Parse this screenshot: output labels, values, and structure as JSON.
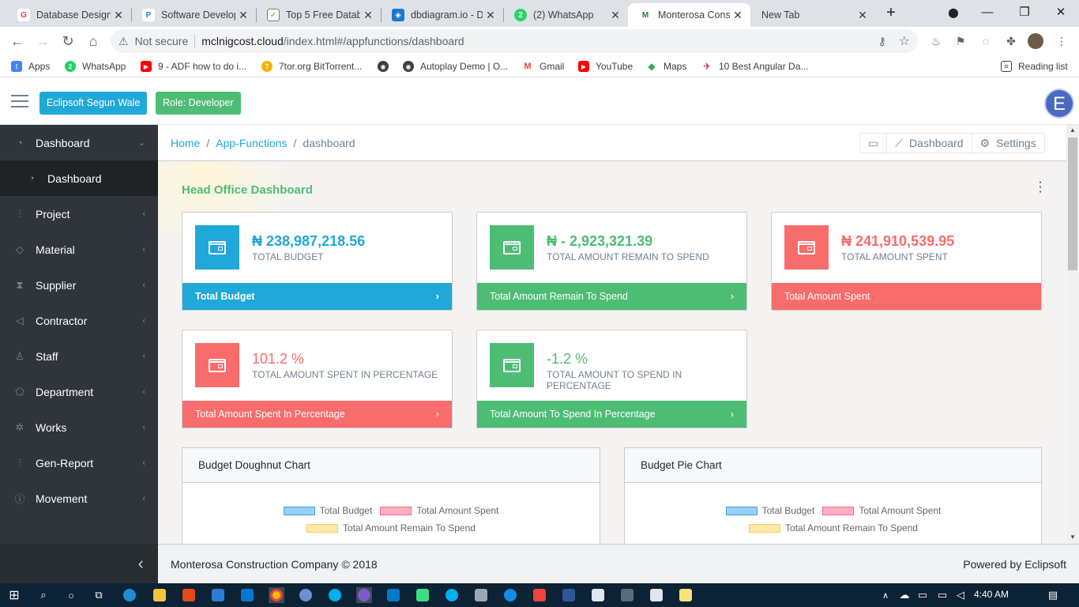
{
  "browser": {
    "tabs": [
      {
        "title": "Database Designi",
        "icon": "google-icon",
        "color": "#ea4335",
        "letter": "G"
      },
      {
        "title": "Software Develop",
        "icon": "p-icon",
        "color": "#1e88e5",
        "letter": "P"
      },
      {
        "title": "Top 5 Free Datab",
        "icon": "shield-check-icon",
        "color": "#43a047",
        "letter": "✓"
      },
      {
        "title": "dbdiagram.io - D",
        "icon": "dbdiagram-icon",
        "color": "#1976d2",
        "letter": "◈"
      },
      {
        "title": "(2) WhatsApp",
        "icon": "whatsapp-icon",
        "color": "#25d366",
        "letter": "2"
      },
      {
        "title": "Monterosa Const",
        "icon": "monterosa-icon",
        "color": "#2e7d32",
        "letter": "M"
      },
      {
        "title": "New Tab",
        "icon": "",
        "color": "",
        "letter": ""
      }
    ],
    "address": {
      "warning": "Not secure",
      "host": "mclnigcost.cloud",
      "path": "/index.html#/appfunctions/dashboard"
    },
    "bookmarks": [
      {
        "label": "Apps",
        "color": "#4285f4",
        "letter": "⋮"
      },
      {
        "label": "WhatsApp",
        "color": "#25d366",
        "letter": "2"
      },
      {
        "label": "9 - ADF how to do i...",
        "color": "#ff0000",
        "letter": "▶"
      },
      {
        "label": "7tor.org BitTorrent...",
        "color": "#f4b400",
        "letter": "7"
      },
      {
        "label": "",
        "color": "#3c4043",
        "letter": "◉"
      },
      {
        "label": "Autoplay Demo | O...",
        "color": "#3c4043",
        "letter": "◉"
      },
      {
        "label": "Gmail",
        "color": "#ea4335",
        "letter": "M"
      },
      {
        "label": "YouTube",
        "color": "#ff0000",
        "letter": "▶"
      },
      {
        "label": "Maps",
        "color": "#34a853",
        "letter": "◆"
      },
      {
        "label": "10 Best Angular Da...",
        "color": "#c62828",
        "letter": "✈"
      }
    ],
    "reading_list": "Reading list"
  },
  "header": {
    "company_button": "Eclipsoft Segun Wale",
    "role_button": "Role: Developer",
    "avatar_letter": "E",
    "company_color": "#20a8d8",
    "role_color": "#4dbd74"
  },
  "sidebar": {
    "items": [
      {
        "label": "Dashboard",
        "icon": "speedometer-icon",
        "glyph": "◔"
      },
      {
        "label": "Dashboard",
        "icon": "speedometer-icon",
        "glyph": "◔"
      },
      {
        "label": "Project",
        "icon": "sliders-icon",
        "glyph": "⫶"
      },
      {
        "label": "Material",
        "icon": "diamond-icon",
        "glyph": "◇"
      },
      {
        "label": "Supplier",
        "icon": "hourglass-icon",
        "glyph": "⧗"
      },
      {
        "label": "Contractor",
        "icon": "paper-plane-icon",
        "glyph": "◁"
      },
      {
        "label": "Staff",
        "icon": "user-icon",
        "glyph": "♙"
      },
      {
        "label": "Department",
        "icon": "tag-icon",
        "glyph": "⬠"
      },
      {
        "label": "Works",
        "icon": "pin-icon",
        "glyph": "✲"
      },
      {
        "label": "Gen-Report",
        "icon": "sliders-icon",
        "glyph": "⫶"
      },
      {
        "label": "Movement",
        "icon": "info-icon",
        "glyph": "ⓘ"
      }
    ]
  },
  "breadcrumb": {
    "home": "Home",
    "section": "App-Functions",
    "current": "dashboard"
  },
  "breadcrumb_menu": {
    "dashboard": "Dashboard",
    "settings": "Settings"
  },
  "dashboard": {
    "title": "Head Office Dashboard",
    "cards": [
      {
        "value": "₦ 238,987,218.56",
        "label": "TOTAL BUDGET",
        "footer": "Total Budget",
        "color": "#20a8d8",
        "has_arrow": true
      },
      {
        "value": "₦ - 2,923,321.39",
        "label": "TOTAL AMOUNT REMAIN TO SPEND",
        "footer": "Total Amount Remain To Spend",
        "color": "#4dbd74",
        "has_arrow": true
      },
      {
        "value": "₦ 241,910,539.95",
        "label": "TOTAL AMOUNT SPENT",
        "footer": "Total Amount Spent",
        "color": "#f86c6b",
        "has_arrow": false
      },
      {
        "value": "101.2 %",
        "label": "TOTAL AMOUNT SPENT IN PERCENTAGE",
        "footer": "Total Amount Spent In Percentage",
        "color": "#f86c6b",
        "has_arrow": true
      },
      {
        "value": "-1.2 %",
        "label": "TOTAL AMOUNT TO SPEND IN PERCENTAGE",
        "footer": "Total Amount To Spend In Percentage",
        "color": "#4dbd74",
        "has_arrow": true
      }
    ],
    "charts": [
      {
        "title": "Budget Doughnut Chart",
        "legend": [
          "Total Budget",
          "Total Amount Spent",
          "Total Amount Remain To Spend"
        ]
      },
      {
        "title": "Budget Pie Chart",
        "legend": [
          "Total Budget",
          "Total Amount Spent",
          "Total Amount Remain To Spend"
        ]
      }
    ],
    "legend_colors": [
      {
        "fill": "#9ad0f5",
        "border": "#36a2eb"
      },
      {
        "fill": "#ffb1c1",
        "border": "#ff6384"
      },
      {
        "fill": "#ffe6aa",
        "border": "#ffcd56"
      }
    ]
  },
  "footer": {
    "left": "Monterosa Construction Company © 2018",
    "right": "Powered by Eclipsoft"
  },
  "taskbar": {
    "time": "4:40 AM"
  }
}
